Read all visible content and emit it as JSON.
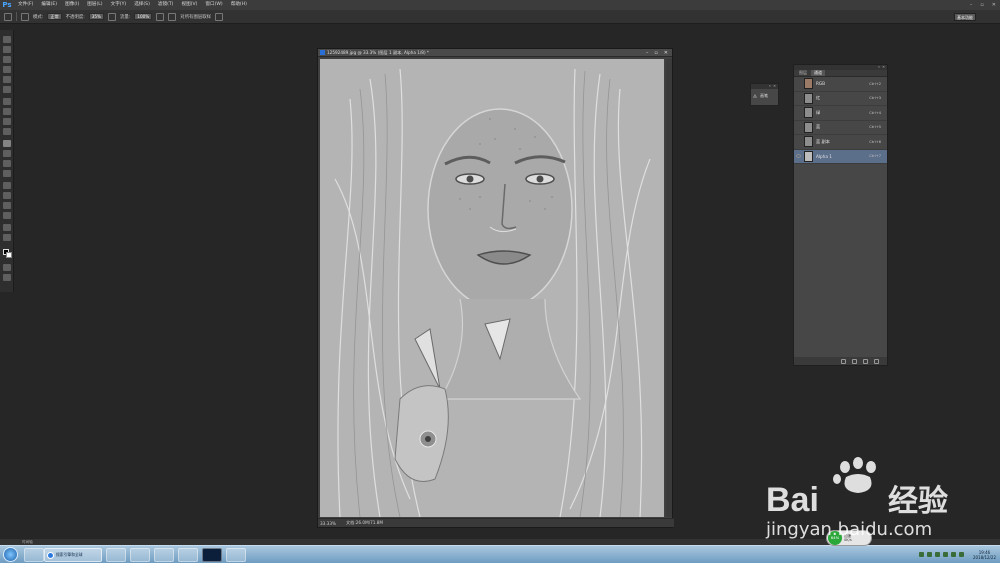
{
  "app": {
    "logo": "Ps"
  },
  "menu": [
    "文件(F)",
    "编辑(E)",
    "图像(I)",
    "图层(L)",
    "文字(Y)",
    "选择(S)",
    "滤镜(T)",
    "视图(V)",
    "窗口(W)",
    "帮助(H)"
  ],
  "window_controls": {
    "minimize": "–",
    "restore": "▫",
    "close": "✕"
  },
  "options": {
    "mode_label": "模式:",
    "mode_value": "正常",
    "opacity_label": "不透明度:",
    "opacity_value": "35%",
    "flow_label": "流量:",
    "flow_value": "100%",
    "sample_all_label": "对所有图层取样",
    "workspace": "基本功能"
  },
  "document": {
    "title": "12592489.jpg @ 33.3% (图层 1 副本, Alpha 1/8) *",
    "zoom": "33.33%",
    "doc_info": "文档:26.0M/71.8M"
  },
  "mini_panel": {
    "label": "画笔"
  },
  "channels_panel": {
    "tabs": [
      "图层",
      "通道"
    ],
    "active_tab": 1,
    "channels": [
      {
        "name": "RGB",
        "shortcut": "Ctrl+2",
        "thumb": "rgb",
        "visible": false,
        "selected": false
      },
      {
        "name": "红",
        "shortcut": "Ctrl+3",
        "thumb": "gray",
        "visible": false,
        "selected": false
      },
      {
        "name": "绿",
        "shortcut": "Ctrl+4",
        "thumb": "gray",
        "visible": false,
        "selected": false
      },
      {
        "name": "蓝",
        "shortcut": "Ctrl+5",
        "thumb": "gray",
        "visible": false,
        "selected": false
      },
      {
        "name": "蓝 副本",
        "shortcut": "Ctrl+6",
        "thumb": "gray",
        "visible": false,
        "selected": false
      },
      {
        "name": "Alpha 1",
        "shortcut": "Ctrl+7",
        "thumb": "alpha",
        "visible": true,
        "selected": true
      }
    ]
  },
  "timeline_label": "时间轴",
  "taskbar": {
    "ie_task": "搜索引擎和全球"
  },
  "clock": {
    "time": "19:46",
    "date": "2018/12/22"
  },
  "badge": {
    "percent": "64%",
    "line1": "加速",
    "line2": "0K/s"
  },
  "watermark": {
    "brand": "Bai",
    "brand_cn": "经验",
    "url": "jingyan.baidu.com"
  },
  "colors": {
    "accent": "#4aa6ff",
    "selection": "#5b6e8a",
    "taskbar": "#8fb4d4"
  }
}
